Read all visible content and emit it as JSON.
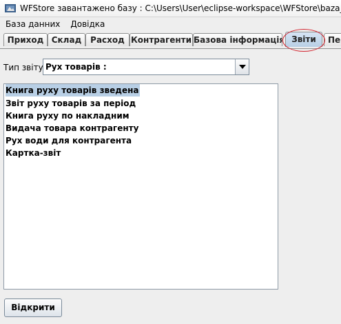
{
  "window": {
    "title": "WFStore завантажено базу : C:\\Users\\User\\eclipse-workspace\\WFStore\\baza_mar",
    "icon": "app-window-icon"
  },
  "menubar": {
    "items": [
      {
        "label": "База данних"
      },
      {
        "label": "Довідка"
      }
    ]
  },
  "tabs": [
    {
      "label": "Приход"
    },
    {
      "label": "Склад"
    },
    {
      "label": "Расход"
    },
    {
      "label": "Контрагенти"
    },
    {
      "label": "Базова інформація"
    },
    {
      "label": "Звіти",
      "selected": true
    },
    {
      "label": "Пер"
    }
  ],
  "report_type": {
    "label": "Тип звіту :",
    "selected": "Рух товарів :"
  },
  "reports": {
    "items": [
      {
        "label": "Книга руху товарів зведена",
        "selected": true
      },
      {
        "label": "Звіт руху товарів за період"
      },
      {
        "label": "Книга руху по накладним"
      },
      {
        "label": "Видача товара контрагенту"
      },
      {
        "label": "Рух води для контрагента"
      },
      {
        "label": "Картка-звіт"
      }
    ]
  },
  "actions": {
    "open_label": "Відкрити"
  },
  "colors": {
    "selection": "#b8cfe5",
    "annotation_circle": "#d21f2a"
  }
}
